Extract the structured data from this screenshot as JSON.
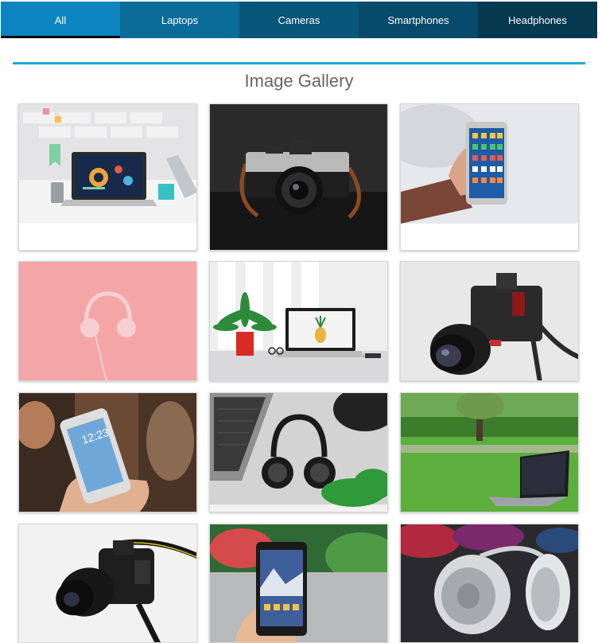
{
  "tabs": [
    {
      "label": "All",
      "bg": "#0b84bf",
      "active": true
    },
    {
      "label": "Laptops",
      "bg": "#0a6c99"
    },
    {
      "label": "Cameras",
      "bg": "#08567a"
    },
    {
      "label": "Smartphones",
      "bg": "#074a6a"
    },
    {
      "label": "Headphones",
      "bg": "#05394f"
    }
  ],
  "gallery": {
    "title": "Image Gallery",
    "items": [
      {
        "subject": "laptop-on-desk"
      },
      {
        "subject": "film-camera"
      },
      {
        "subject": "hand-holding-smartphone"
      },
      {
        "subject": "pink-headphones"
      },
      {
        "subject": "laptop-with-plant"
      },
      {
        "subject": "mirrorless-camera"
      },
      {
        "subject": "hand-holding-iphone"
      },
      {
        "subject": "headphones-laptop-flatlay"
      },
      {
        "subject": "laptop-on-grass"
      },
      {
        "subject": "dslr-camera"
      },
      {
        "subject": "hand-holding-android-phone"
      },
      {
        "subject": "silver-headphones"
      }
    ]
  },
  "colors": {
    "accent": "#21a8d6",
    "title": "#666666"
  }
}
